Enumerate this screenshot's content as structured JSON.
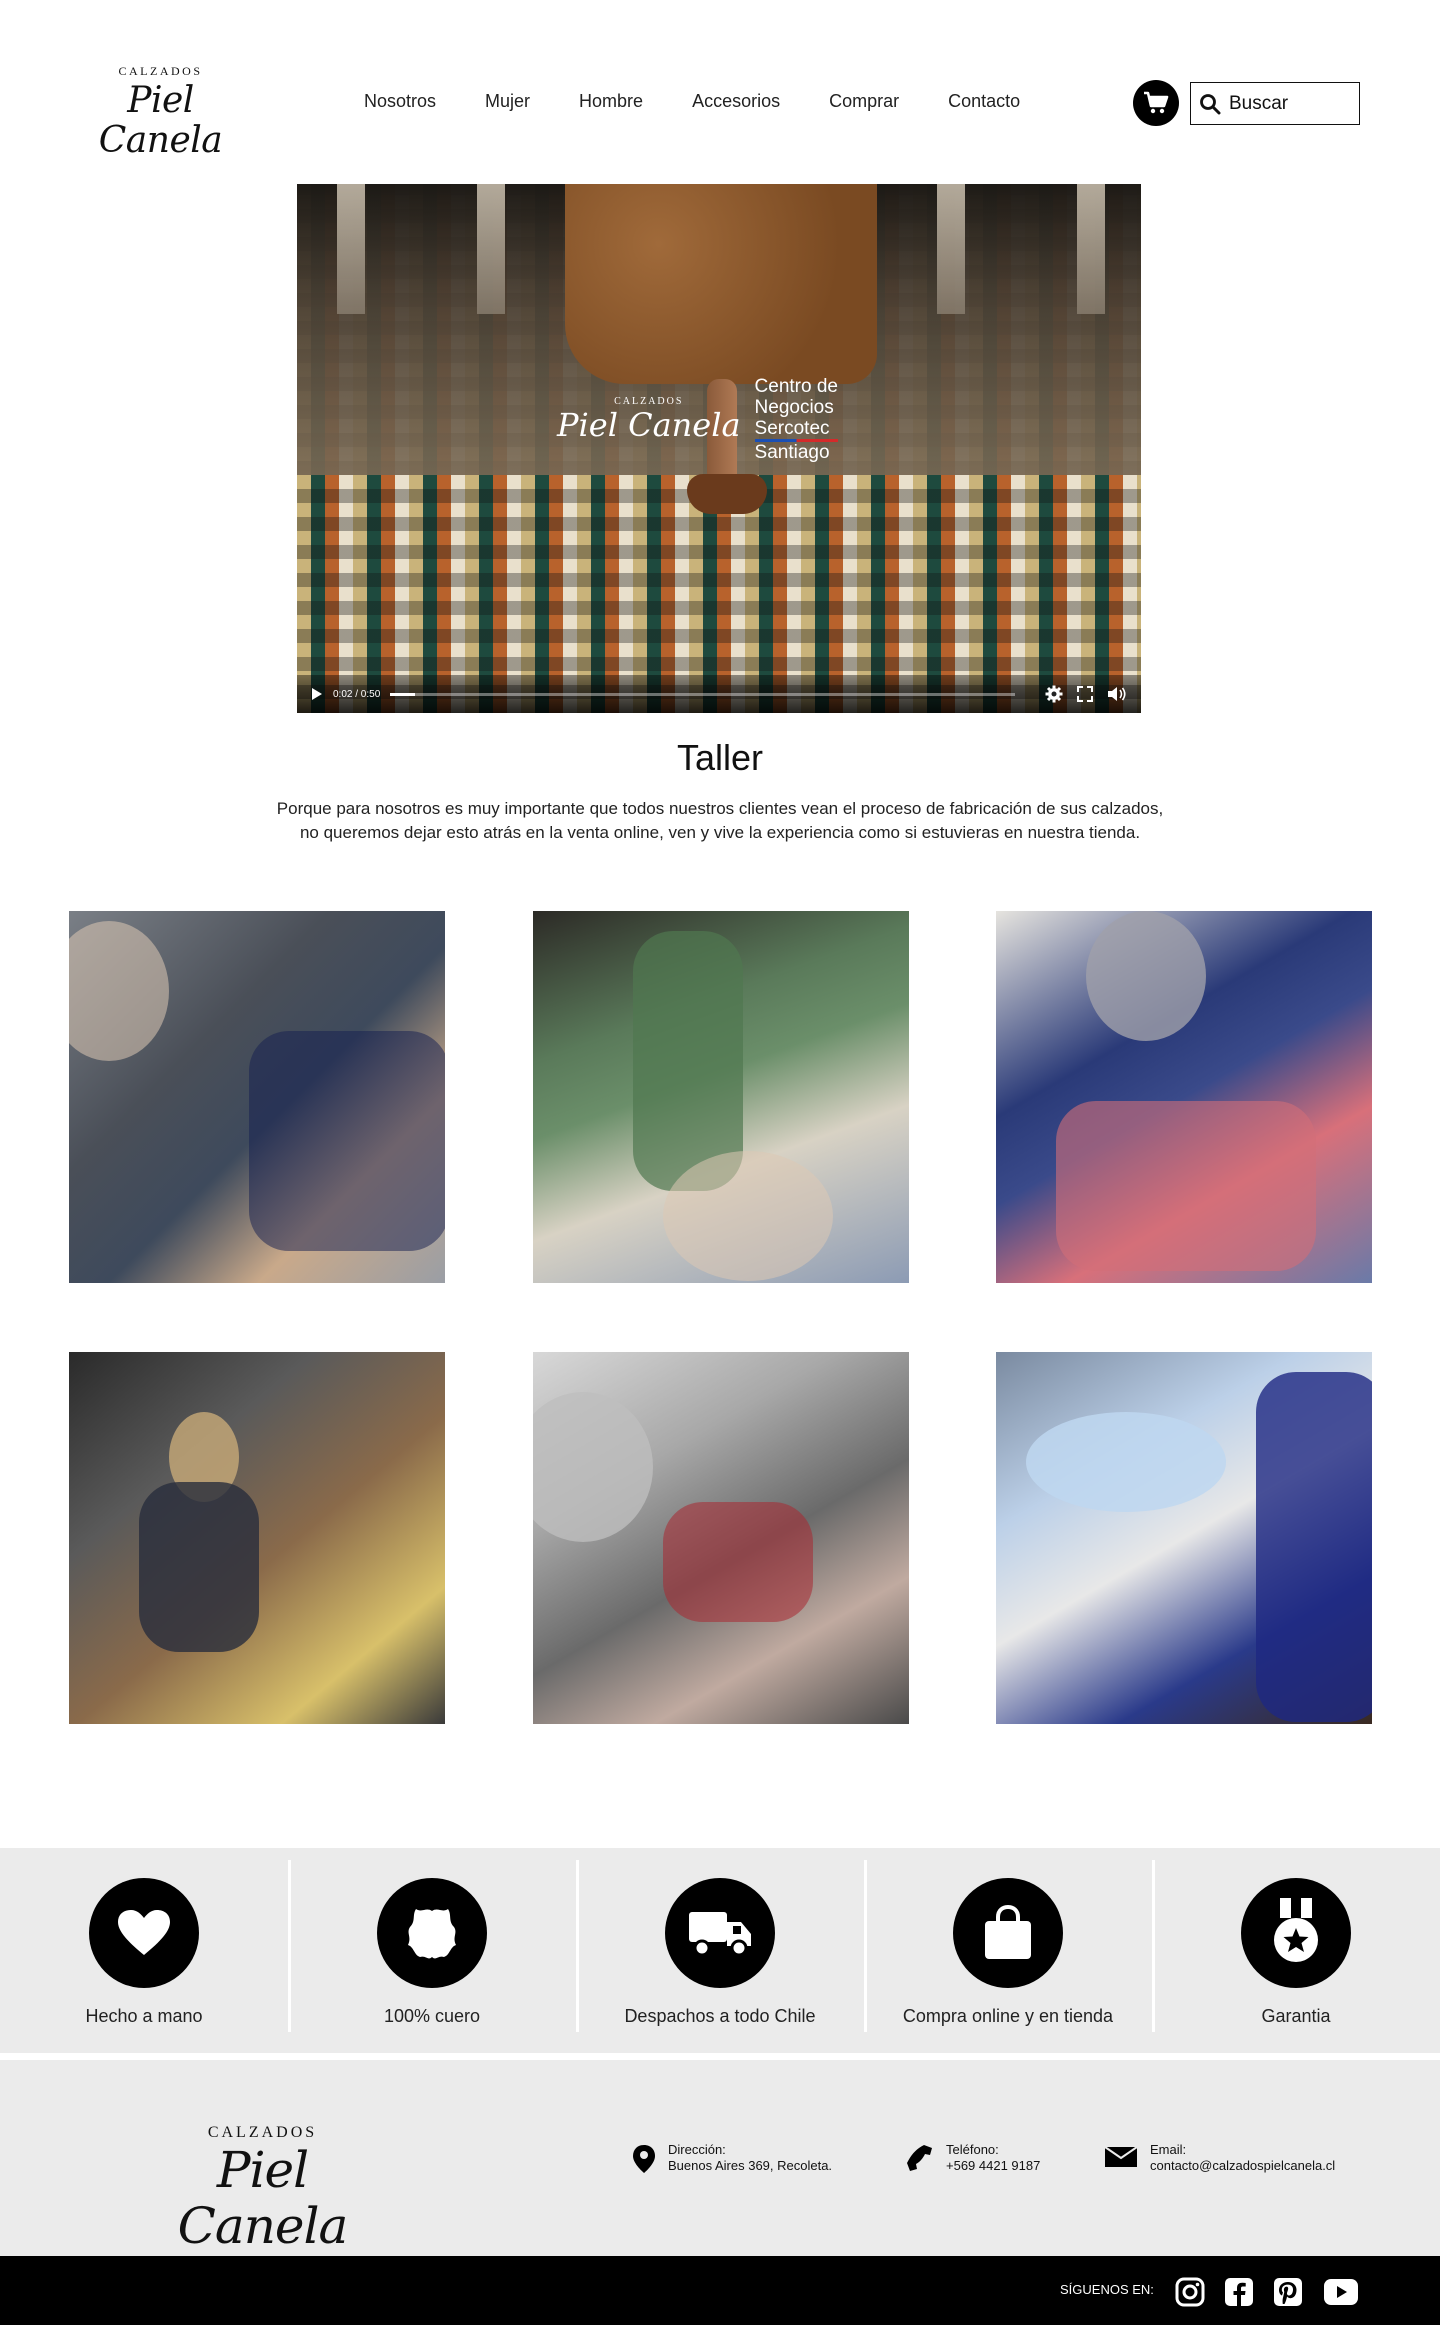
{
  "header": {
    "logo_small": "CALZADOS",
    "logo_main": "Piel Canela",
    "nav": [
      "Nosotros",
      "Mujer",
      "Hombre",
      "Accesorios",
      "Comprar",
      "Contacto"
    ],
    "search_placeholder": "Buscar"
  },
  "video": {
    "overlay_logo_small": "CALZADOS",
    "overlay_logo_main": "Piel Canela",
    "overlay_text": [
      "Centro de",
      "Negocios",
      "Sercotec",
      "Santiago"
    ],
    "time": "0:02 / 0:50",
    "progress": 0.04
  },
  "taller": {
    "title": "Taller",
    "text_line1": "Porque para nosotros es muy importante que todos nuestros clientes vean el proceso de fabricación de sus calzados,",
    "text_line2": "no queremos dejar esto atrás en la venta online, ven y vive la experiencia como si estuvieras en nuestra tienda."
  },
  "features": [
    {
      "label": "Hecho a mano",
      "icon": "heart-icon"
    },
    {
      "label": "100% cuero",
      "icon": "leather-icon"
    },
    {
      "label": "Despachos a todo Chile",
      "icon": "truck-icon"
    },
    {
      "label": "Compra online y en tienda",
      "icon": "shopping-bag-icon"
    },
    {
      "label": "Garantia",
      "icon": "medal-icon"
    }
  ],
  "footer": {
    "logo_small": "CALZADOS",
    "logo_main": "Piel Canela",
    "address_label": "Dirección:",
    "address_value": "Buenos Aires 369, Recoleta.",
    "phone_label": "Teléfono:",
    "phone_value": "+569 4421 9187",
    "email_label": "Email:",
    "email_value": "contacto@calzadospielcanela.cl",
    "follow_label": "SÍGUENOS EN:"
  }
}
